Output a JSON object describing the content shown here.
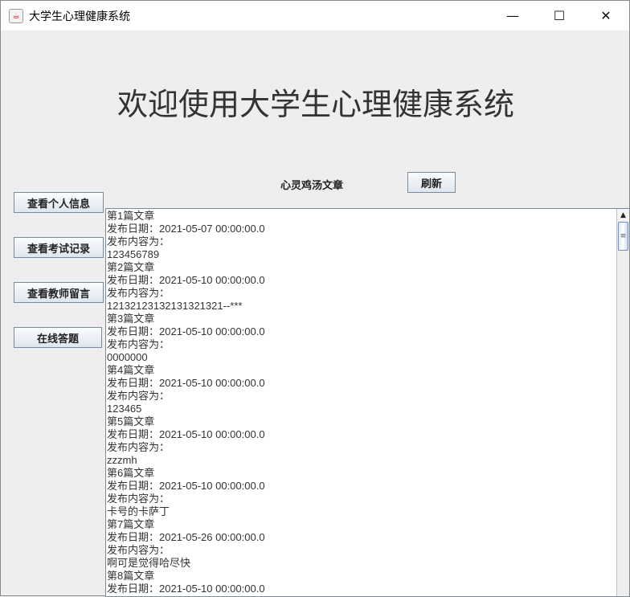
{
  "window": {
    "title": "大学生心理健康系统",
    "minimize": "—",
    "maximize": "☐",
    "close": "✕"
  },
  "header": {
    "heading": "欢迎使用大学生心理健康系统"
  },
  "articles_label": "心灵鸡汤文章",
  "refresh_label": "刷新",
  "sidebar": [
    {
      "label": "查看个人信息"
    },
    {
      "label": "查看考试记录"
    },
    {
      "label": "查看教师留言"
    },
    {
      "label": "在线答题"
    }
  ],
  "articles": [
    {
      "title": "第1篇文章",
      "date": "发布日期：2021-05-07 00:00:00.0",
      "content_label": "发布内容为：",
      "content": "123456789"
    },
    {
      "title": "第2篇文章",
      "date": "发布日期：2021-05-10 00:00:00.0",
      "content_label": "发布内容为：",
      "content": "12132123132131321321--***"
    },
    {
      "title": "第3篇文章",
      "date": "发布日期：2021-05-10 00:00:00.0",
      "content_label": "发布内容为：",
      "content": "0000000"
    },
    {
      "title": "第4篇文章",
      "date": "发布日期：2021-05-10 00:00:00.0",
      "content_label": "发布内容为：",
      "content": "123465"
    },
    {
      "title": "第5篇文章",
      "date": "发布日期：2021-05-10 00:00:00.0",
      "content_label": "发布内容为：",
      "content": "zzzmh"
    },
    {
      "title": "第6篇文章",
      "date": "发布日期：2021-05-10 00:00:00.0",
      "content_label": "发布内容为：",
      "content": "卡号的卡萨丁"
    },
    {
      "title": "第7篇文章",
      "date": "发布日期：2021-05-26 00:00:00.0",
      "content_label": "发布内容为：",
      "content": "啊可是觉得哈尽快"
    },
    {
      "title": "第8篇文章",
      "date": "发布日期：2021-05-10 00:00:00.0",
      "content_label": "",
      "content": ""
    }
  ]
}
